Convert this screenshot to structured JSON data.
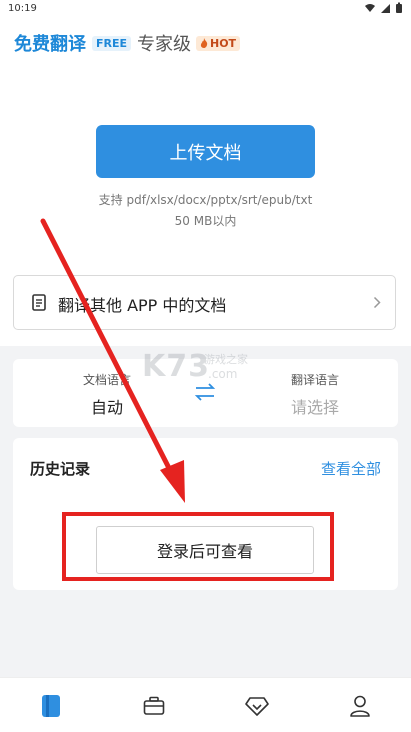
{
  "status_bar": {
    "time": "10:19"
  },
  "header": {
    "tab_free": {
      "label": "免费翻译",
      "badge": "FREE"
    },
    "tab_expert": {
      "label": "专家级",
      "badge": "HOT"
    }
  },
  "upload": {
    "button_label": "上传文档",
    "supported_formats": "支持 pdf/xlsx/docx/pptx/srt/epub/txt",
    "size_limit": "50 MB以内"
  },
  "other_app": {
    "label": "翻译其他 APP 中的文档"
  },
  "language": {
    "source_title": "文档语言",
    "source_value": "自动",
    "target_title": "翻译语言",
    "target_value": "请选择"
  },
  "watermark": {
    "brand": "K73",
    "site_cn": "游戏之家",
    "domain": ".com"
  },
  "history": {
    "title": "历史记录",
    "view_all": "查看全部",
    "login_button": "登录后可查看"
  },
  "bottom_nav": {
    "items": [
      {
        "icon": "document-icon",
        "active": true
      },
      {
        "icon": "briefcase-icon",
        "active": false
      },
      {
        "icon": "diamond-icon",
        "active": false
      },
      {
        "icon": "person-icon",
        "active": false
      }
    ]
  },
  "colors": {
    "accent": "#2f8fe0",
    "annotation_red": "#e52320",
    "hot_badge": "#c24a1a"
  }
}
